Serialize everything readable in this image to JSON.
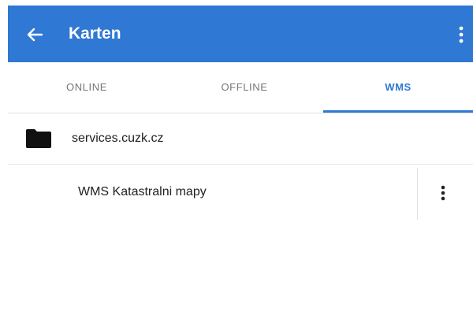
{
  "appbar": {
    "title": "Karten",
    "back_icon": "arrow-left-icon",
    "menu_icon": "more-vert-icon",
    "color": "#2f78d4"
  },
  "tabs": [
    {
      "label": "ONLINE",
      "active": false
    },
    {
      "label": "OFFLINE",
      "active": false
    },
    {
      "label": "WMS",
      "active": true
    }
  ],
  "folder": {
    "icon": "folder-icon",
    "label": "services.cuzk.cz"
  },
  "item": {
    "label": "WMS Katastralni mapy",
    "menu_icon": "more-vert-icon"
  }
}
